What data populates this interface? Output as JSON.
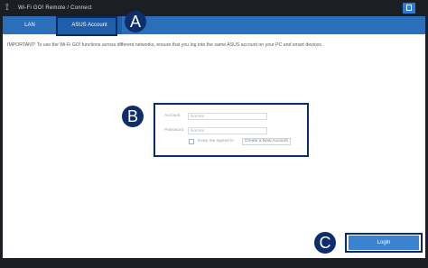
{
  "window": {
    "title": "Wi-Fi GO! Remote / Connect"
  },
  "tabs": [
    {
      "label": "LAN"
    },
    {
      "label": "ASUS Account"
    }
  ],
  "notice": "IMPORTANT! To use the Wi-Fi GO! functions across different networks, ensure that you log into the same ASUS account on your PC and smart devices.",
  "login": {
    "account_label": "Account",
    "account_placeholder": "Normal",
    "password_label": "Password",
    "password_placeholder": "Normal",
    "keep_signed_in": "Keep me signed in",
    "create_account": "Create a New Account",
    "login_button": "Login"
  },
  "callouts": {
    "a": "A",
    "b": "B",
    "c": "C"
  },
  "colors": {
    "tabbar": "#2b6fba",
    "active_tab": "#1f5ea9",
    "callout": "#0d2d6b",
    "login_button": "#3b83d1",
    "chrome": "#1b1f24"
  }
}
